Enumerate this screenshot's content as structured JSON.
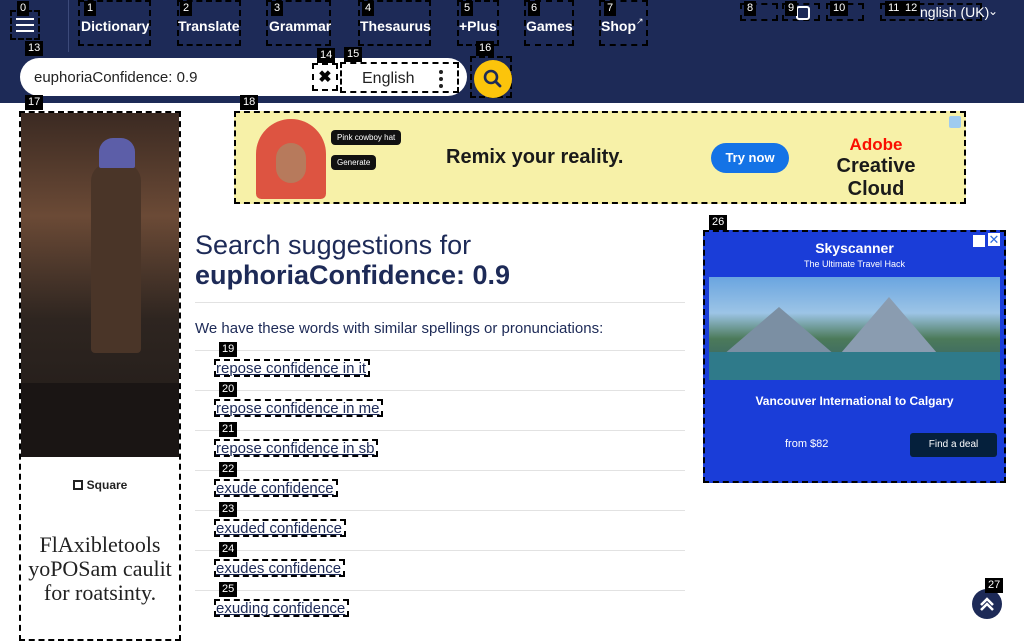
{
  "header": {
    "nav": [
      {
        "num": "1",
        "label": "Dictionary"
      },
      {
        "num": "2",
        "label": "Translate"
      },
      {
        "num": "3",
        "label": "Grammar"
      },
      {
        "num": "4",
        "label": "Thesaurus"
      },
      {
        "num": "5",
        "label": "+Plus"
      },
      {
        "num": "6",
        "label": "Games"
      },
      {
        "num": "7",
        "label": "Shop"
      }
    ],
    "menu_num": "0",
    "icon_nums": [
      "8",
      "9",
      "10",
      "11"
    ],
    "language": {
      "num": "12",
      "label": "nglish (UK)"
    }
  },
  "search": {
    "num": "13",
    "value": "euphoriaConfidence: 0.9",
    "clear_num": "14",
    "dict_num": "15",
    "dict_label": "English",
    "submit_num": "16"
  },
  "ads": {
    "left_num": "17",
    "left_brand": "Square",
    "left_text": "FlAxibletools yoPOSam caulit for roatsinty.",
    "top_num": "18",
    "top_headline": "Remix your reality.",
    "top_button": "Try now",
    "top_brand": "Adobe",
    "top_product": "Creative Cloud",
    "top_chip1": "Pink cowboy hat",
    "top_chip2": "Generate",
    "right_num": "26",
    "right_brand": "Skyscanner",
    "right_tag": "The Ultimate Travel Hack",
    "right_route": "Vancouver International to Calgary",
    "right_price": "from $82",
    "right_button": "Find a deal"
  },
  "main": {
    "title_line1": "Search suggestions for",
    "title_line2": "euphoriaConfidence: 0.9",
    "intro": "We have these words with similar spellings or pronunciations:",
    "suggestions": [
      {
        "num": "19",
        "text": "repose confidence in it"
      },
      {
        "num": "20",
        "text": "repose confidence in me"
      },
      {
        "num": "21",
        "text": "repose confidence in sb"
      },
      {
        "num": "22",
        "text": "exude confidence"
      },
      {
        "num": "23",
        "text": "exuded confidence"
      },
      {
        "num": "24",
        "text": "exudes confidence"
      },
      {
        "num": "25",
        "text": "exuding confidence"
      }
    ]
  },
  "back_to_top_num": "27"
}
